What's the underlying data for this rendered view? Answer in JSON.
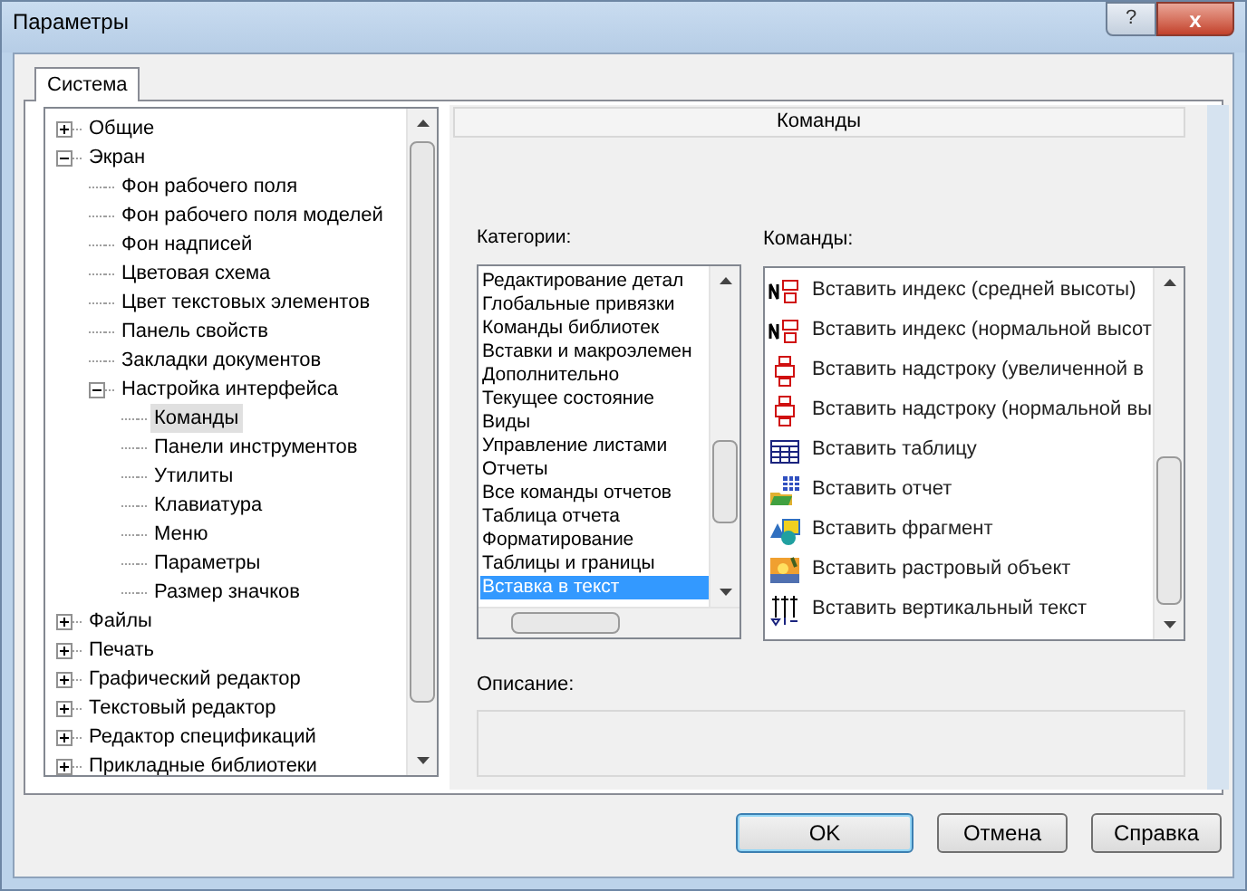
{
  "window": {
    "title": "Параметры",
    "buttons": [
      "?",
      "x"
    ]
  },
  "tabs": [
    {
      "label": "Система",
      "selected": true
    }
  ],
  "tree": [
    {
      "label": "Общие",
      "expanded": false,
      "selected": false
    },
    {
      "label": "Экран",
      "expanded": true,
      "selected": false,
      "children": [
        {
          "label": "Фон рабочего поля",
          "selected": false
        },
        {
          "label": "Фон рабочего поля моделей",
          "selected": false
        },
        {
          "label": "Фон надписей",
          "selected": false
        },
        {
          "label": "Цветовая схема",
          "selected": false
        },
        {
          "label": "Цвет текстовых элементов",
          "selected": false
        },
        {
          "label": "Панель свойств",
          "selected": false
        },
        {
          "label": "Закладки документов",
          "selected": false
        },
        {
          "label": "Настройка интерфейса",
          "expanded": true,
          "selected": false,
          "children": [
            {
              "label": "Команды",
              "selected": true
            },
            {
              "label": "Панели инструментов",
              "selected": false
            },
            {
              "label": "Утилиты",
              "selected": false
            },
            {
              "label": "Клавиатура",
              "selected": false
            },
            {
              "label": "Меню",
              "selected": false
            },
            {
              "label": "Параметры",
              "selected": false
            },
            {
              "label": "Размер значков",
              "selected": false
            }
          ]
        }
      ]
    },
    {
      "label": "Файлы",
      "expanded": false,
      "selected": false
    },
    {
      "label": "Печать",
      "expanded": false,
      "selected": false
    },
    {
      "label": "Графический редактор",
      "expanded": false,
      "selected": false
    },
    {
      "label": "Текстовый редактор",
      "expanded": false,
      "selected": false
    },
    {
      "label": "Редактор спецификаций",
      "expanded": false,
      "selected": false
    },
    {
      "label": "Прикладные библиотеки",
      "expanded": false,
      "selected": false
    }
  ],
  "panel": {
    "title": "Команды",
    "categories_label": "Категории:",
    "categories": [
      {
        "label": "Редактирование детал",
        "selected": false
      },
      {
        "label": "Глобальные привязки",
        "selected": false
      },
      {
        "label": "Команды библиотек",
        "selected": false
      },
      {
        "label": "Вставки и макроэлемен",
        "selected": false
      },
      {
        "label": "Дополнительно",
        "selected": false
      },
      {
        "label": "Текущее состояние",
        "selected": false
      },
      {
        "label": "Виды",
        "selected": false
      },
      {
        "label": "Управление листами",
        "selected": false
      },
      {
        "label": "Отчеты",
        "selected": false
      },
      {
        "label": "Все команды отчетов",
        "selected": false
      },
      {
        "label": "Таблица отчета",
        "selected": false
      },
      {
        "label": "Форматирование",
        "selected": false
      },
      {
        "label": "Таблицы и границы",
        "selected": false
      },
      {
        "label": "Вставка в текст",
        "selected": true
      }
    ],
    "commands_label": "Команды:",
    "commands": [
      {
        "kind": "index",
        "label": "Вставить индекс (средней высоты)"
      },
      {
        "kind": "index",
        "label": "Вставить индекс (нормальной высот"
      },
      {
        "kind": "superscript",
        "label": "Вставить надстроку (увеличенной в"
      },
      {
        "kind": "superscript",
        "label": "Вставить надстроку (нормальной вы"
      },
      {
        "kind": "table",
        "label": "Вставить таблицу"
      },
      {
        "kind": "report",
        "label": "Вставить отчет"
      },
      {
        "kind": "fragment",
        "label": "Вставить фрагмент"
      },
      {
        "kind": "raster",
        "label": "Вставить растровый объект"
      },
      {
        "kind": "vertical",
        "label": "Вставить вертикальный текст"
      }
    ],
    "description_label": "Описание:"
  },
  "buttons": [
    {
      "label": "OK",
      "default": true
    },
    {
      "label": "Отмена",
      "default": false
    },
    {
      "label": "Справка",
      "default": false
    }
  ]
}
